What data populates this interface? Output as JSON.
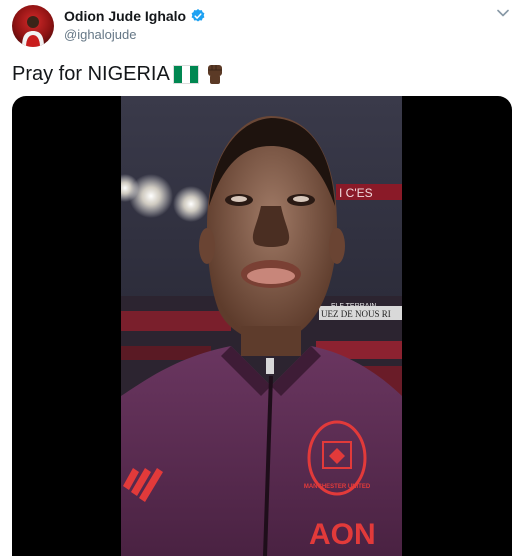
{
  "user": {
    "display_name": "Odion Jude Ighalo",
    "handle": "@ighalojude",
    "verified": true
  },
  "tweet": {
    "text": "Pray for NIGERIA",
    "emojis": [
      "nigeria-flag",
      "raised-fist-dark-skin-tone"
    ]
  },
  "media": {
    "type": "video",
    "stadium_banner_top": "I C'ES",
    "stadium_banner_left": "ELF TERRAIN",
    "stadium_banner_mid": "UEZ DE NOUS RI",
    "club_crest_text": "MANCHESTER UNITED",
    "sponsor_text": "AON"
  },
  "colors": {
    "verified": "#1da1f2",
    "flag_green": "#008751",
    "jacket": "#5a2a4e"
  }
}
